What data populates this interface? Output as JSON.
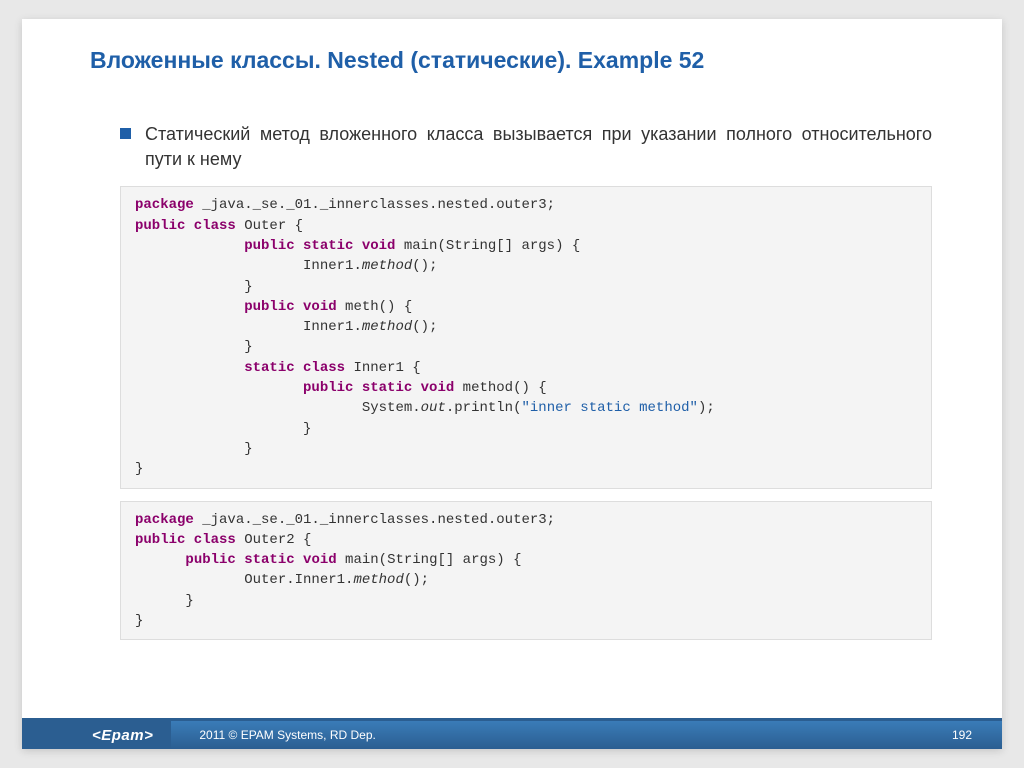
{
  "title": "Вложенные классы. Nested (статические). Example 52",
  "bullet": "Статический метод вложенного класса вызывается при указании полного относительного пути к нему",
  "code1": {
    "l1a": "package",
    "l1b": " _java._se._01._innerclasses.nested.outer3;",
    "l2a": "public class",
    "l2b": " Outer {",
    "l3a": "public static void",
    "l3b": " main(String[] args) {",
    "l4a": "Inner1.",
    "l4b": "method",
    "l4c": "();",
    "l5": "}",
    "l6a": "public void",
    "l6b": " meth() {",
    "l7a": "Inner1.",
    "l7b": "method",
    "l7c": "();",
    "l8": "}",
    "l9a": "static class",
    "l9b": " Inner1 {",
    "l10a": "public static void",
    "l10b": " method() {",
    "l11a": "System.",
    "l11b": "out",
    "l11c": ".println(",
    "l11d": "\"inner static method\"",
    "l11e": ");",
    "l12": "}",
    "l13": "}",
    "l14": "}"
  },
  "code2": {
    "l1a": "package",
    "l1b": " _java._se._01._innerclasses.nested.outer3;",
    "l2a": "public class",
    "l2b": " Outer2 {",
    "l3a": "public static void",
    "l3b": " main(String[] args) {",
    "l4a": "Outer.Inner1.",
    "l4b": "method",
    "l4c": "();",
    "l5": "}",
    "l6": "}"
  },
  "footer": {
    "logo": "<Epam>",
    "copyright": "2011 © EPAM Systems, RD Dep.",
    "page": "192"
  }
}
